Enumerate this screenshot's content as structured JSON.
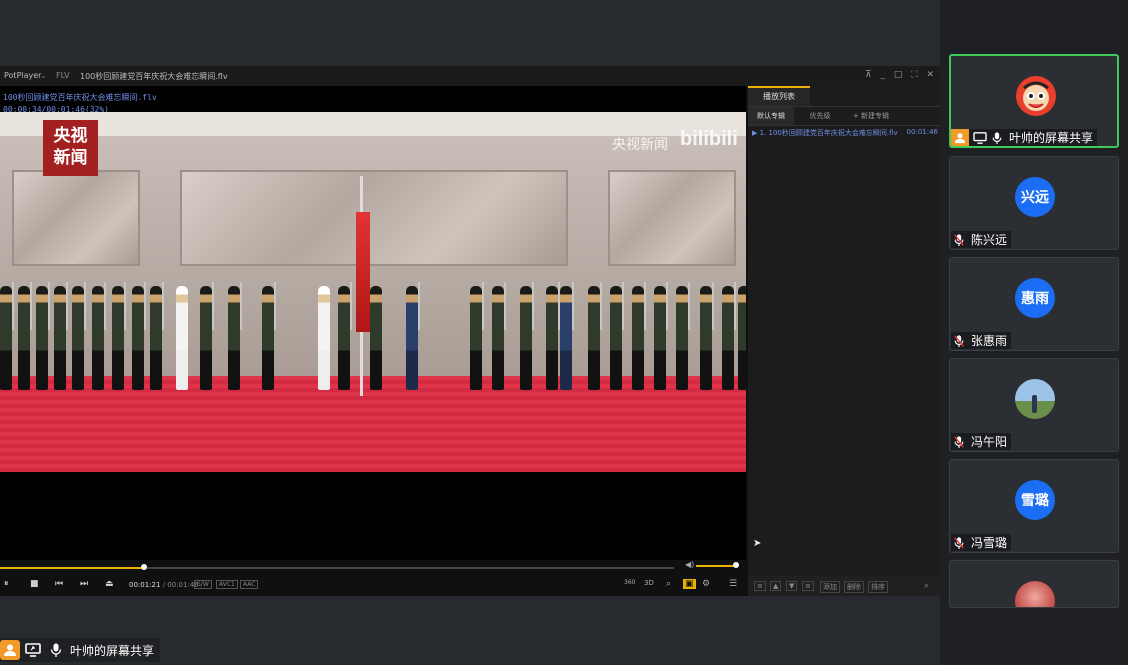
{
  "player": {
    "app_name": "PotPlayer",
    "format": "FLV",
    "file_title": "100秒回顾建党百年庆祝大会难忘瞬间.flv",
    "window_controls": [
      "⊼",
      "_",
      "□",
      "⛶",
      "✕"
    ],
    "osd_filename": "100秒回顾建党百年庆祝大会难忘瞬间.flv",
    "osd_time": "00:00:34/00:01:46(32%)",
    "logo_text_line1": "央视",
    "logo_text_line2": "新闻",
    "watermark": "央视新闻",
    "watermark2": "bilibili",
    "progress_fraction": 0.213,
    "time_current": "00:01:21",
    "time_total": "00:01:46",
    "tags": [
      "S/W",
      "AVC1",
      "AAC"
    ],
    "right_controls": [
      "360",
      "3D",
      "⌕",
      "▣",
      "⚙",
      "☰"
    ],
    "volume_fraction": 0.9
  },
  "playlist": {
    "title": "播放列表",
    "tabs": [
      "默认专辑",
      "优先级",
      "+ 新建专辑"
    ],
    "items": [
      {
        "name": "▶ 1. 100秒回顾建党百年庆祝大会难忘瞬间.flv",
        "duration": "00:01:46"
      }
    ],
    "footer_buttons": [
      "添加",
      "删除",
      "排序"
    ]
  },
  "bottom_sharer": {
    "label": "叶帅的屏幕共享"
  },
  "participants": [
    {
      "name": "叶帅的屏幕共享",
      "avatar": "cartoon-avatar",
      "active": true
    },
    {
      "name": "陈兴远",
      "avatar_text": "兴远"
    },
    {
      "name": "张惠雨",
      "avatar_text": "惠雨"
    },
    {
      "name": "冯午阳",
      "avatar": "photo-avatar"
    },
    {
      "name": "冯雪璐",
      "avatar_text": "雪璐"
    },
    {
      "name": "",
      "avatar": "photo-avatar"
    }
  ],
  "colors": {
    "accent": "#e9b200",
    "speaking": "#3ec95a",
    "avatar_blue": "#1b6ef3"
  }
}
